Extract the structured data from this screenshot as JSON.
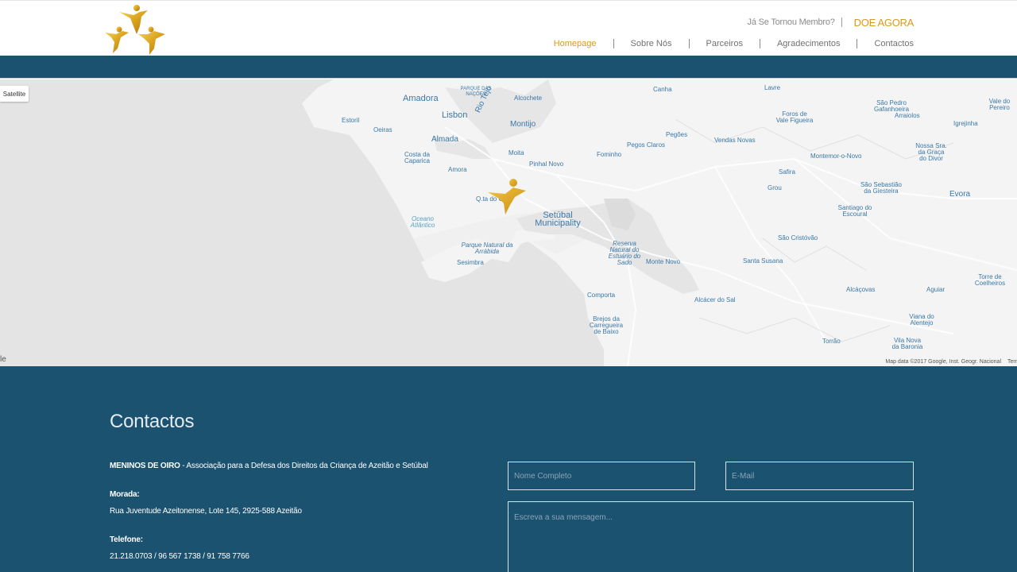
{
  "header": {
    "member_link": "Já Se Tornou Membro?",
    "donate_link": "DOE AGORA",
    "nav": [
      {
        "label": "Homepage",
        "active": true
      },
      {
        "label": "Sobre Nós",
        "active": false
      },
      {
        "label": "Parceiros",
        "active": false
      },
      {
        "label": "Agradecimentos",
        "active": false
      },
      {
        "label": "Contactos",
        "active": false
      }
    ]
  },
  "map": {
    "satellite_button": "Satellite",
    "google_mark": "le",
    "attribution": "Map data ©2017 Google, Inst. Geogr. Nacional",
    "terms": "Terms",
    "labels": {
      "amadora": "Amadora",
      "parque_nacoes": "PARQUE DAS NAÇÕES",
      "alcochete": "Alcochete",
      "canha": "Canha",
      "lavre": "Lavre",
      "sao_pedro": "São Pedro Gafanhoeira",
      "vale_pereiro": "Vale do Pereiro",
      "estoril": "Estoril",
      "oeiras": "Oeiras",
      "lisbon": "Lisbon",
      "rio_tejo": "Rio Tejo",
      "montijo": "Montijo",
      "pegoes": "Pegões",
      "foros": "Foros de Vale Figueira",
      "arraiolos": "Arraiolos",
      "igrejinha": "Igrejinha",
      "almada": "Almada",
      "pegos_claros": "Pegos Claros",
      "vendas_novas": "Vendas Novas",
      "nossa_sra": "Nossa Sra. da Graça do Divor",
      "costa_caparica": "Costa da Caparica",
      "moita": "Moita",
      "fominho": "Fominho",
      "montemor": "Montemor-o-Novo",
      "amora": "Amora",
      "pinhal_novo": "Pinhal Novo",
      "safira": "Safira",
      "grou": "Grou",
      "sao_sebastiao": "São Sebastião da Giesteira",
      "evora": "Evora",
      "quinta_conde": "Q.ta do Conde",
      "setubal": "Setúbal Municipality",
      "santiago": "Santiago do Escoural",
      "oceano": "Oceano Atlântico",
      "sao_cristovao": "São Cristóvão",
      "parque_arrabida": "Parque Natural da Arrábida",
      "reserva_sado": "Reserva Natural do Estuário do Sado",
      "monte_novo": "Monte Novo",
      "santa_susana": "Santa Susana",
      "sesimbra": "Sesimbra",
      "torre_coelheiros": "Torre de Coelheiros",
      "alcacovas": "Alcáçovas",
      "aguiar": "Aguiar",
      "comporta": "Comporta",
      "alcacer": "Alcácer do Sal",
      "brejos": "Brejos da Carregueira de Baixo",
      "viana": "Viana do Alentejo",
      "torrao": "Torrão",
      "vila_nova": "Vila Nova da Baronia"
    }
  },
  "contact": {
    "title": "Contactos",
    "org_name": "MENINOS DE OIRO",
    "org_desc": " - Associação para a Defesa dos Direitos da Criança de Azeitão e Setúbal",
    "address_label": "Morada:",
    "address_value": "Rua Juventude Azeitonense, Lote 145, 2925-588 Azeitão",
    "phone_label": "Telefone:",
    "phone_value": "21.218.0703 / 96 567 1738 / 91 758 7766",
    "name_placeholder": "Nome Completo",
    "email_placeholder": "E-Mail",
    "message_placeholder": "Escreva a sua mensagem..."
  },
  "colors": {
    "brand_blue": "#1b5270",
    "gold": "#d79a1a"
  }
}
